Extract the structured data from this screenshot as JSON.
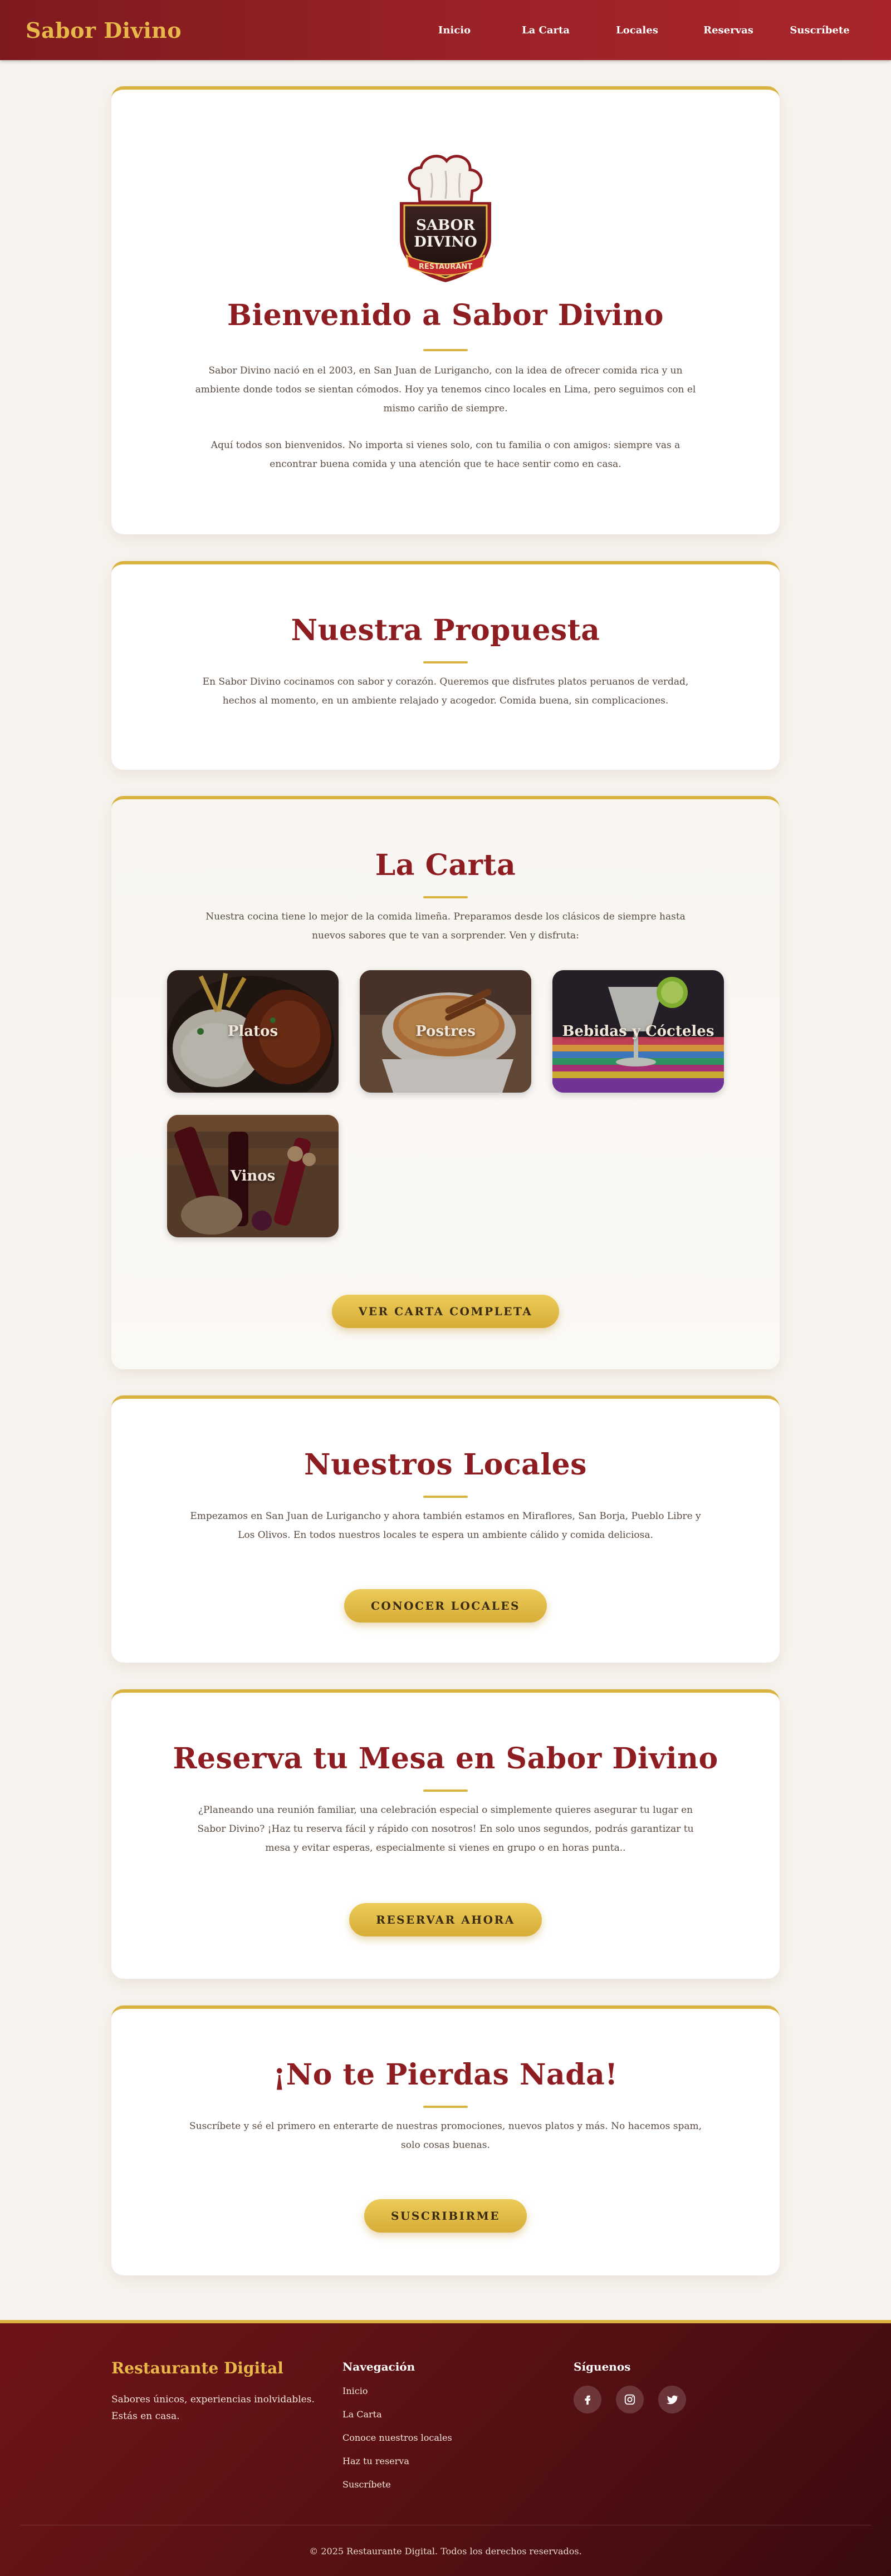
{
  "header": {
    "brand": "Sabor Divino",
    "nav": [
      {
        "label": "Inicio"
      },
      {
        "label": "La Carta"
      },
      {
        "label": "Locales"
      },
      {
        "label": "Reservas"
      },
      {
        "label": "Suscríbete"
      }
    ]
  },
  "welcome": {
    "logo_text": {
      "top": "SABOR",
      "bottom": "DIVINO",
      "ribbon": "RESTAURANT"
    },
    "title": "Bienvenido a Sabor Divino",
    "p1_line1": "Sabor Divino nació en el 2003, en San Juan de Lurigancho, con la idea de ofrecer comida rica y un",
    "p1_line2": "ambiente donde todos se sientan cómodos. Hoy ya tenemos cinco locales en Lima, pero seguimos con el",
    "p1_line3": "mismo cariño de siempre.",
    "p2_line1": "Aquí todos son bienvenidos. No importa si vienes solo, con tu familia o con amigos: siempre vas a",
    "p2_line2": "encontrar buena comida y una atención que te hace sentir como en casa."
  },
  "proposal": {
    "title": "Nuestra Propuesta",
    "line1": "En Sabor Divino cocinamos con sabor y corazón. Queremos que disfrutes platos peruanos de verdad,",
    "line2": "hechos al momento, en un ambiente relajado y acogedor. Comida buena, sin complicaciones."
  },
  "menu": {
    "title": "La Carta",
    "line1": "Nuestra cocina tiene lo mejor de la comida limeña. Preparamos desde los clásicos de siempre hasta",
    "line2": "nuevos sabores que te van a sorprender. Ven y disfruta:",
    "categories": [
      {
        "label": "Platos"
      },
      {
        "label": "Postres"
      },
      {
        "label": "Bebidas y Cócteles"
      },
      {
        "label": "Vinos"
      }
    ],
    "button": "Ver Carta Completa"
  },
  "locations": {
    "title": "Nuestros Locales",
    "line1": "Empezamos en San Juan de Lurigancho y ahora también estamos en Miraflores, San Borja, Pueblo Libre y",
    "line2": "Los Olivos. En todos nuestros locales te espera un ambiente cálido y comida deliciosa.",
    "button": "Conocer Locales"
  },
  "reservation": {
    "title": "Reserva tu Mesa en Sabor Divino",
    "line1": "¿Planeando una reunión familiar, una celebración especial o simplemente quieres asegurar tu lugar en",
    "line2": "Sabor Divino? ¡Haz tu reserva fácil y rápido con nosotros! En solo unos segundos, podrás garantizar tu",
    "line3": "mesa y evitar esperas, especialmente si vienes en grupo o en horas punta..",
    "button": "Reservar Ahora"
  },
  "newsletter": {
    "title": "¡No te Pierdas Nada!",
    "line1": "Suscríbete y sé el primero en enterarte de nuestras promociones, nuevos platos y más. No hacemos spam,",
    "line2": "solo cosas buenas.",
    "button": "Suscribirme"
  },
  "footer": {
    "brand": "Restaurante Digital",
    "tagline1": "Sabores únicos, experiencias inolvidables.",
    "tagline2": "Estás en casa.",
    "nav_title": "Navegación",
    "links": [
      {
        "label": "Inicio"
      },
      {
        "label": "La Carta"
      },
      {
        "label": "Conoce nuestros locales"
      },
      {
        "label": "Haz tu reserva"
      },
      {
        "label": "Suscríbete"
      }
    ],
    "social_title": "Síguenos",
    "social": [
      {
        "icon": "facebook-icon"
      },
      {
        "icon": "instagram-icon"
      },
      {
        "icon": "twitter-icon"
      }
    ],
    "copyright": "© 2025 Restaurante Digital. Todos los derechos reservados."
  },
  "colors": {
    "brand_red": "#8e1d22",
    "gold": "#d9b23f",
    "header_red": "#9c2227",
    "footer_dark": "#5a1114"
  }
}
